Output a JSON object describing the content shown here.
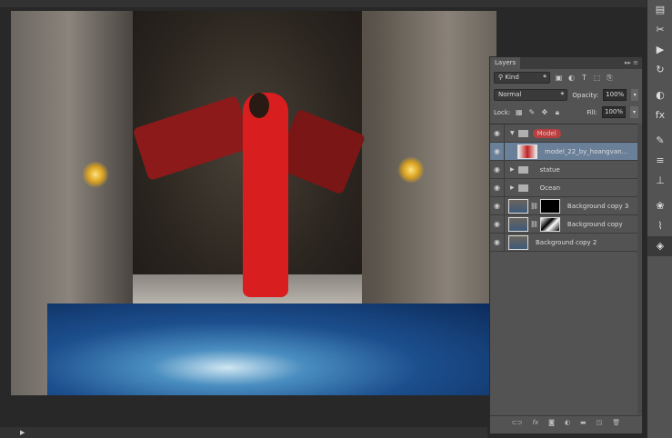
{
  "layers_panel": {
    "tab": "Layers",
    "filter_kind": "Kind",
    "blend_mode": "Normal",
    "opacity_label": "Opacity:",
    "opacity": "100%",
    "lock_label": "Lock:",
    "fill_label": "Fill:",
    "fill": "100%",
    "layers": [
      {
        "name": "Model",
        "type": "group",
        "expanded": true,
        "highlight_color": "#b84040"
      },
      {
        "name": "model_22_by_hoangvan...",
        "type": "smart-object",
        "selected": true
      },
      {
        "name": "statue",
        "type": "group",
        "expanded": false
      },
      {
        "name": "Ocean",
        "type": "group",
        "expanded": false
      },
      {
        "name": "Background copy 3",
        "type": "layer-with-mask"
      },
      {
        "name": "Background copy",
        "type": "layer-with-mask"
      },
      {
        "name": "Background copy 2",
        "type": "layer"
      }
    ],
    "footer_icons": [
      "link-icon",
      "fx-icon",
      "mask-icon",
      "adjustment-icon",
      "folder-icon",
      "new-layer-icon",
      "trash-icon"
    ]
  },
  "colors": {
    "panel": "#535353",
    "selected_layer": "#6a7f98",
    "canvas_bg": "#282828"
  }
}
